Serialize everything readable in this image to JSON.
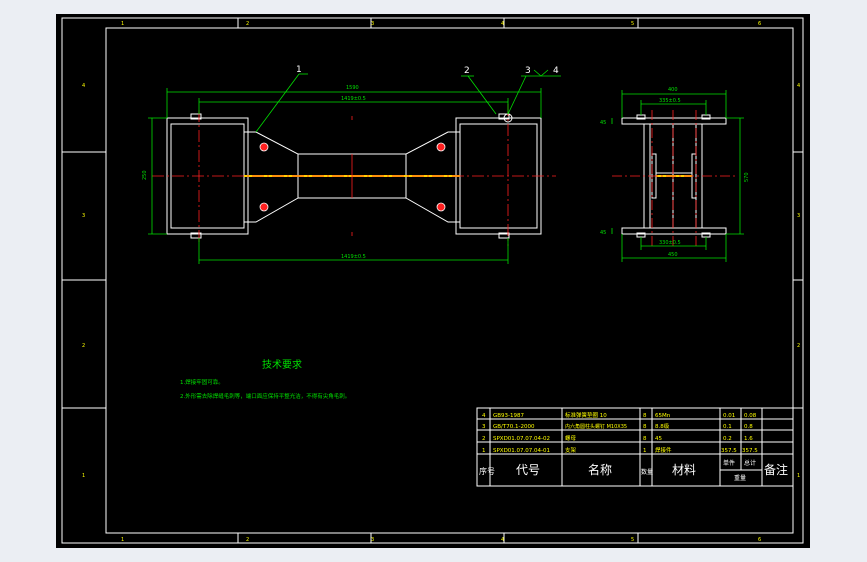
{
  "frame": {
    "zone_numbers_top": [
      "1",
      "2",
      "3",
      "4",
      "5",
      "6"
    ],
    "zone_numbers_bottom": [
      "1",
      "2",
      "3",
      "4",
      "5",
      "6"
    ],
    "zone_letters_left": [
      "4",
      "3",
      "2",
      "1"
    ],
    "zone_letters_right": [
      "4",
      "3",
      "2",
      "1"
    ]
  },
  "front_view": {
    "balloons": [
      "1",
      "2",
      "3",
      "4"
    ],
    "dim_overall_top": "1590",
    "dim_inner_top": "1419±0.5",
    "dim_bottom": "1419±0.5",
    "dim_left_height": "250"
  },
  "side_view": {
    "dim_top": "400",
    "dim_top_inner": "335±0.5",
    "dim_bottom": "450",
    "dim_bottom_inner": "330±0.5",
    "dim_right": "570",
    "dim_small_top": "45",
    "dim_small_bottom": "45"
  },
  "notes": {
    "title": "技术要求",
    "lines": [
      "1.焊接牢固可靠。",
      "2.外形需去除焊缝毛刺等，端口面应保持平整光洁，不得有尖角毛刺。"
    ]
  },
  "bom": {
    "rows": [
      {
        "no": "4",
        "code": "GB93-1987",
        "name": "标准弹簧垫圈 10",
        "qty": "8",
        "material": "65Mn",
        "single": "0.01",
        "total": "0.08"
      },
      {
        "no": "3",
        "code": "GB/T70.1-2000",
        "name": "内六角圆柱头螺钉 M10X35",
        "qty": "8",
        "material": "8.8级",
        "single": "0.1",
        "total": "0.8"
      },
      {
        "no": "2",
        "code": "SPXD01.07.07.04-02",
        "name": "螺母",
        "qty": "8",
        "material": "45",
        "single": "0.2",
        "total": "1.6"
      },
      {
        "no": "1",
        "code": "SPXD01.07.07.04-01",
        "name": "支架",
        "qty": "1",
        "material": "焊接件",
        "single": "357.5",
        "total": "357.5"
      }
    ],
    "header": {
      "no": "序号",
      "code": "代号",
      "name": "名称",
      "qty": "数量",
      "material": "材料",
      "single": "单件",
      "total": "总计",
      "weight": "重量",
      "remark": "备注"
    }
  },
  "colors": {
    "background": "#000000",
    "outline": "#ffffff",
    "dimension": "#00e000",
    "centerline": "#ff2020",
    "weld": "#ffd200",
    "text": "#ffff00",
    "app_bg": "#ebeef3"
  }
}
